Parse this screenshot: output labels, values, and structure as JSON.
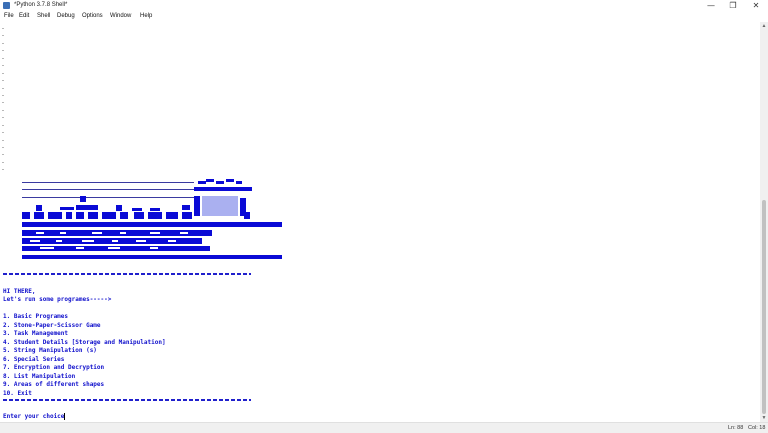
{
  "window": {
    "title": "*Python 3.7.8 Shell*",
    "minimize_glyph": "—",
    "maximize_glyph": "❐",
    "close_glyph": "✕",
    "icon": "python-idle-icon"
  },
  "menu": [
    "File",
    "Edit",
    "Shell",
    "Debug",
    "Options",
    "Window",
    "Help"
  ],
  "colors": {
    "output_text": "#1111cc",
    "background": "#ffffff",
    "art": "#0a0ad6",
    "art_light": "#aab0f0"
  },
  "shell": {
    "dot_glyph": "-",
    "greeting": "HI THERE,",
    "subtitle": "Let's run some programes----->",
    "options": [
      "1. Basic Programes",
      "2. Stone-Paper-Scissor Game",
      "3. Task Management",
      "4. Student Details [Storage and Manipulation]",
      "5. String Manipulation (s)",
      "6. Special Series",
      "7. Encryption and Decryption",
      "8. List Manipulation",
      "9. Areas of different shapes",
      "10. Exit"
    ],
    "prompt": "Enter your choice"
  },
  "status": {
    "line": "Ln: 88",
    "col": "Col: 18"
  }
}
